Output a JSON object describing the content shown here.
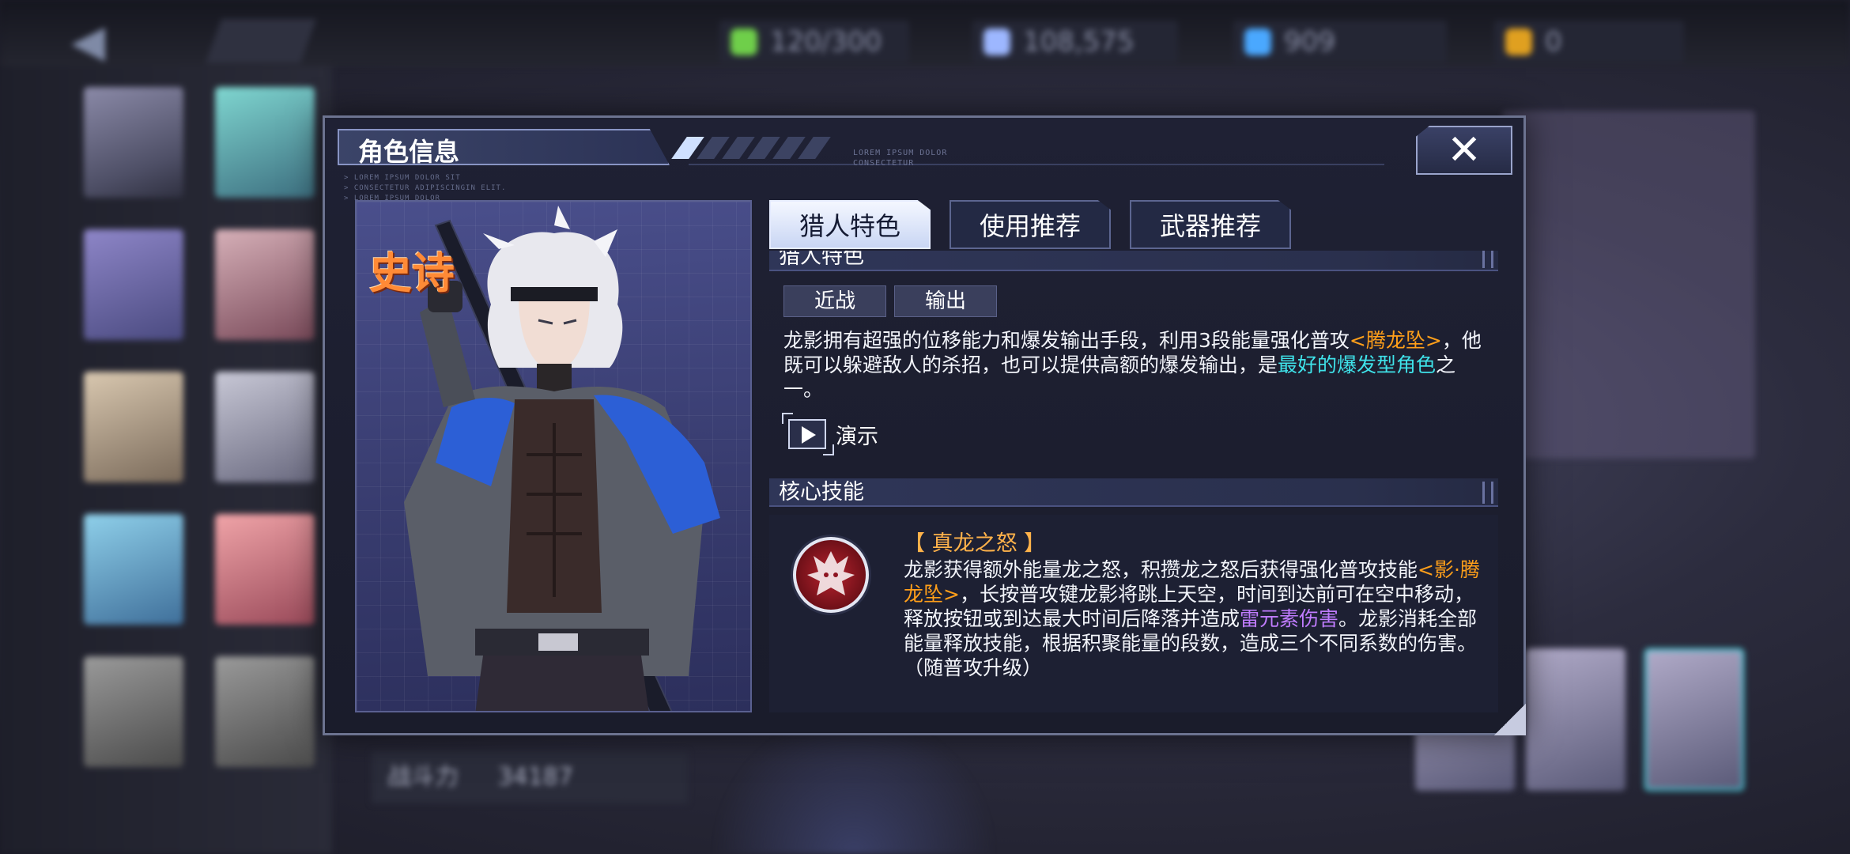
{
  "background": {
    "resources": [
      {
        "value": "120/300",
        "icon": "stamina-icon",
        "color": "#6fcf4a"
      },
      {
        "value": "108,575",
        "icon": "crystal-icon",
        "color": "#9db7ff"
      },
      {
        "value": "909",
        "icon": "ticket-icon",
        "color": "#4aa8ff"
      },
      {
        "value": "0",
        "icon": "gold-ticket-icon",
        "color": "#e0a020"
      }
    ],
    "combat_power_label": "战斗力",
    "combat_power_value": "34187"
  },
  "dialog": {
    "title": "角色信息",
    "lorem_top": "LOREM IPSUM DOLOR\nCONSECTETUR",
    "lorem_side": "> LOREM IPSUM DOLOR SIT\n> CONSECTETUR ADIPISCINGIN ELIT.\n> LOREM IPSUM DOLOR",
    "close_icon": "close-x-icon"
  },
  "character": {
    "rarity": "史诗"
  },
  "tabs": [
    {
      "label": "猎人特色",
      "active": true
    },
    {
      "label": "使用推荐",
      "active": false
    },
    {
      "label": "武器推荐",
      "active": false
    }
  ],
  "traits": {
    "section_title": "猎人特色",
    "tags": [
      "近战",
      "输出"
    ],
    "desc_part1": "龙影拥有超强的位移能力和爆发输出手段，利用3段能量强化普攻",
    "desc_hl1": "<腾龙坠>",
    "desc_part2": "，他既可以躲避敌人的杀招，也可以提供高额的爆发输出，是",
    "desc_hl2": "最好的爆发型角色",
    "desc_part3": "之一。",
    "demo_label": "演示"
  },
  "skill": {
    "section_title": "核心技能",
    "name": "【 真龙之怒 】",
    "desc_part1": "龙影获得额外能量龙之怒，积攒龙之怒后获得强化普攻技能",
    "desc_hl1": "<影·腾龙坠>",
    "desc_part2": "，长按普攻键龙影将跳上天空，时间到达前可在空中移动，释放按钮或到达最大时间后降落并造成",
    "desc_hl2": "雷元素伤害",
    "desc_part3": "。龙影消耗全部能量释放技能，根据积聚能量的段数，造成三个不同系数的伤害。（随普攻升级）",
    "icon": "dragon-head-icon"
  },
  "colors": {
    "highlight_orange": "#ff9f1a",
    "highlight_cyan": "#3fe3ea",
    "highlight_purple": "#c07cff",
    "rarity_orange": "#ff8a36"
  }
}
